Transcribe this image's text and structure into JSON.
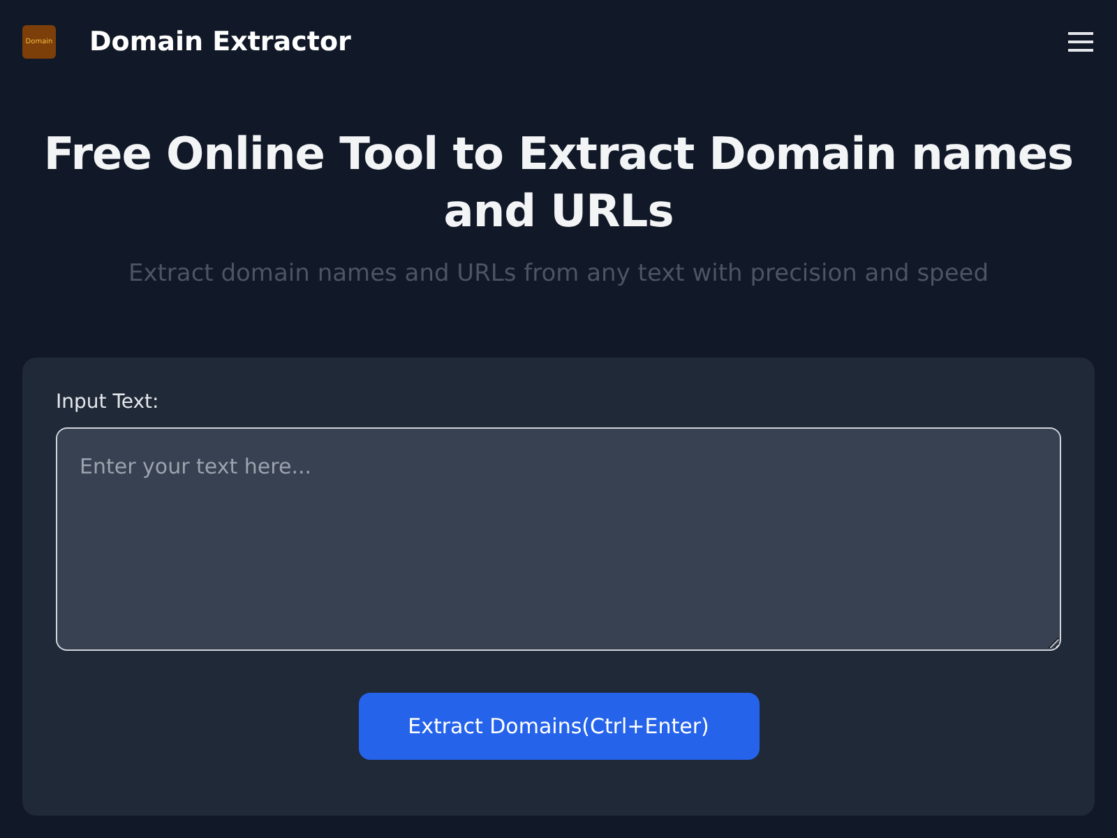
{
  "header": {
    "logo_text": "Domain",
    "title": "Domain Extractor"
  },
  "hero": {
    "heading": "Free Online Tool to Extract Domain names and URLs",
    "subtitle": "Extract domain names and URLs from any text with precision and speed"
  },
  "form": {
    "label": "Input Text:",
    "placeholder": "Enter your text here...",
    "button": "Extract Domains(Ctrl+Enter)"
  }
}
